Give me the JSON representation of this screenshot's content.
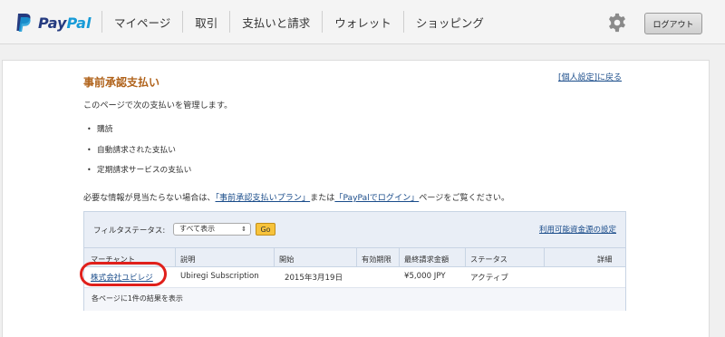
{
  "header": {
    "logo_pay": "Pay",
    "logo_pal": "Pal",
    "nav": [
      "マイページ",
      "取引",
      "支払いと請求",
      "ウォレット",
      "ショッピング"
    ],
    "logout_label": "ログアウト",
    "icons": {
      "settings": "gear-icon"
    }
  },
  "page": {
    "title": "事前承認支払い",
    "back_link": "[個人設定]に戻る",
    "intro": "このページで次の支払いを管理します。",
    "bullets": [
      "購読",
      "自動請求された支払い",
      "定期請求サービスの支払い"
    ],
    "note_prefix": "必要な情報が見当たらない場合は、",
    "note_link1": "「事前承認支払いプラン」",
    "note_middle": "または",
    "note_link2": "「PayPalでログイン」",
    "note_suffix": "ページをご覧ください。"
  },
  "filter": {
    "label": "フィルタステータス:",
    "selected": "すべて表示",
    "go_label": "Go",
    "funding_link": "利用可能資金源の設定"
  },
  "table": {
    "headers": [
      "マーチャント",
      "説明",
      "開始",
      "有効期限",
      "最終請求金額",
      "ステータス",
      "詳細"
    ],
    "rows": [
      {
        "merchant": "株式会社ユビレジ",
        "description": "Ubiregi Subscription",
        "start": "2015年3月19日",
        "expiry": "",
        "last_amount": "¥5,000 JPY",
        "status": "アクティブ",
        "details": ""
      }
    ],
    "footer": "各ページに1件の結果を表示"
  },
  "colors": {
    "title": "#b0621a",
    "link": "#1a4c8a",
    "highlight": "#e0201b",
    "go_button": "#f7c33b"
  }
}
